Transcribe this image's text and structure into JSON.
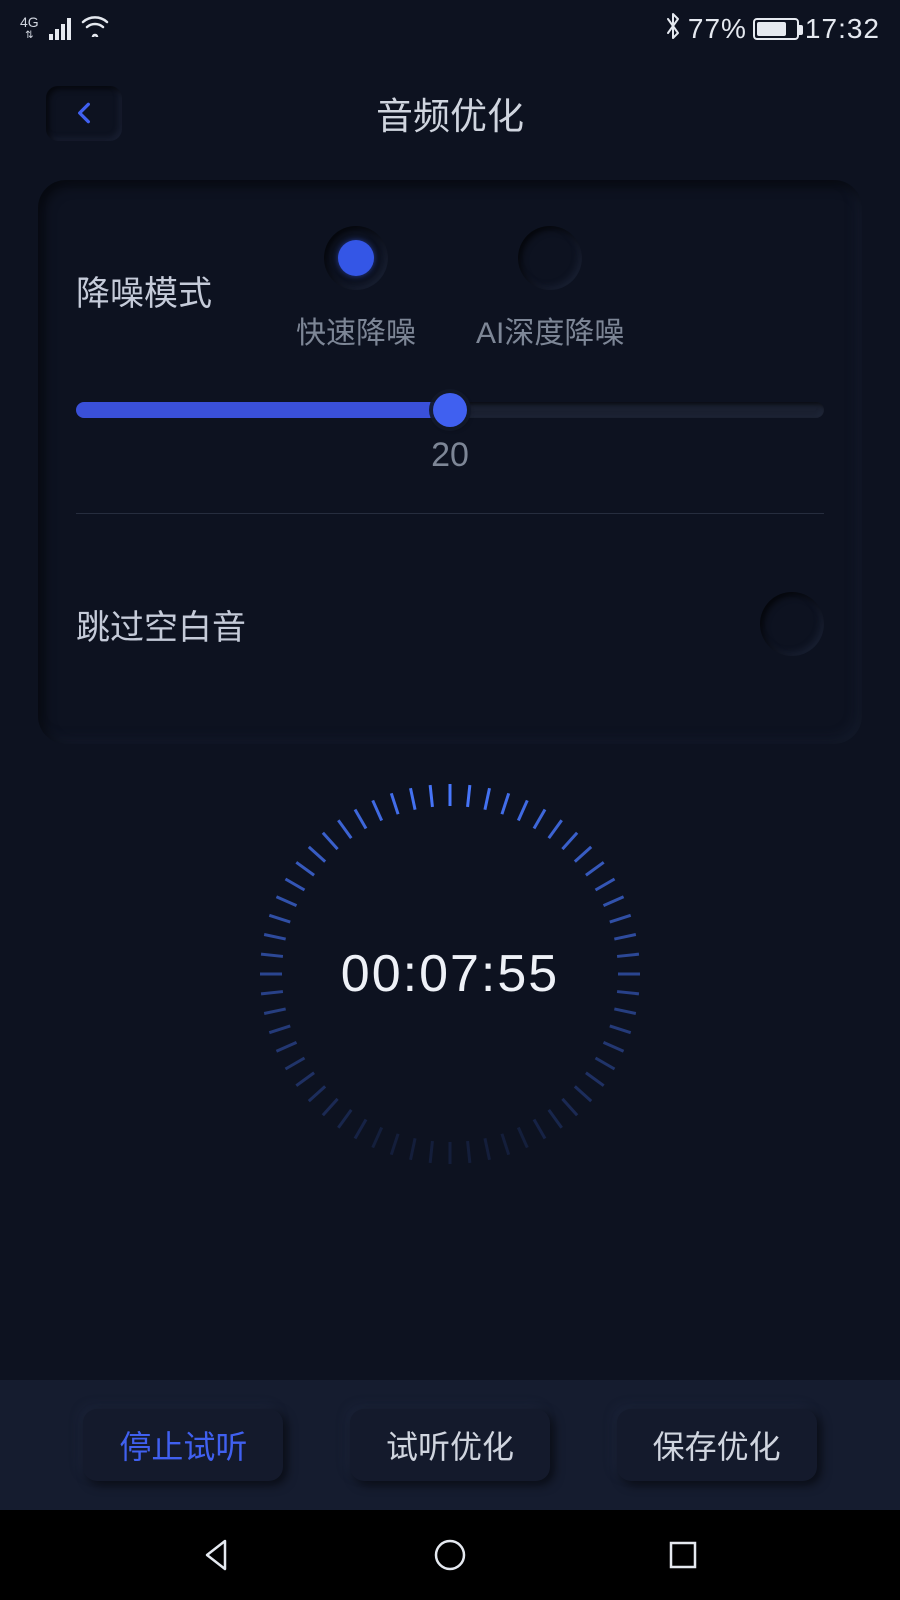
{
  "status": {
    "network_label": "4G",
    "battery_pct": "77%",
    "clock": "17:32"
  },
  "header": {
    "title": "音频优化"
  },
  "card": {
    "mode_label": "降噪模式",
    "option1": "快速降噪",
    "option2": "AI深度降噪",
    "selected_index": 0,
    "slider_value": "20",
    "skip_label": "跳过空白音"
  },
  "timer": {
    "display": "00:07:55"
  },
  "actions": {
    "stop": "停止试听",
    "preview": "试听优化",
    "save": "保存优化"
  }
}
